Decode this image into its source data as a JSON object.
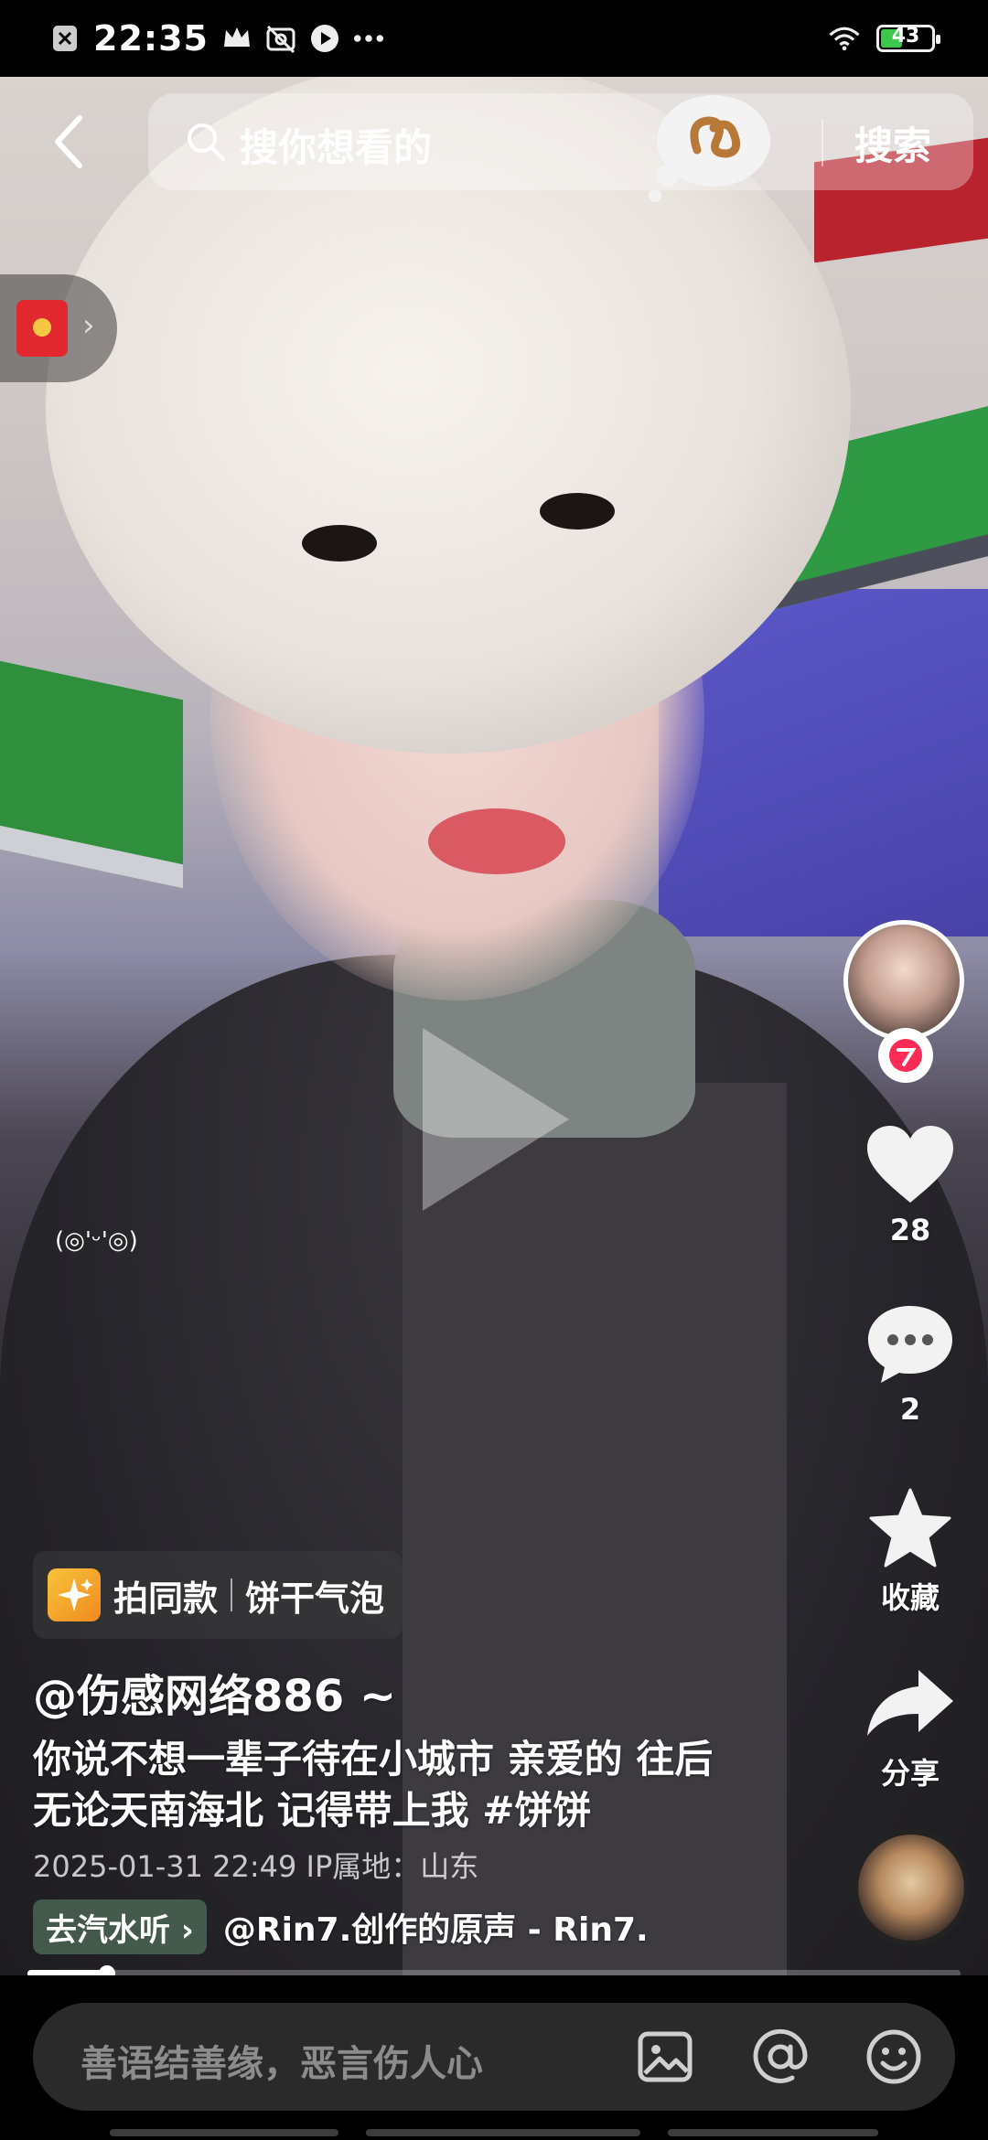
{
  "status_bar": {
    "time": "22:35",
    "battery": "43",
    "battery_level": 0.43
  },
  "top_bar": {
    "search_placeholder": "搜你想看的",
    "search_button": "搜索"
  },
  "video": {
    "overlay_emote": "(◎'ᵕ'◎)"
  },
  "side_rail": {
    "like_count": "28",
    "comment_count": "2",
    "favorite_label": "收藏",
    "share_label": "分享"
  },
  "info": {
    "same_style_label": "拍同款",
    "effect_name": "饼干气泡",
    "author": "@伤感网络886 ~",
    "caption": "你说不想一辈子待在小城市 亲爱的 往后无论天南海北 记得带上我 #饼饼",
    "date_location": "2025-01-31 22:49 IP属地：山东",
    "listen_button": "去汽水听 ›",
    "music": "@Rin7.创作的原声 - Rin7."
  },
  "progress": {
    "played_fraction": 0.085
  },
  "comment_bar": {
    "placeholder": "善语结善缘，恶言伤人心"
  },
  "icons": [
    "close-box-icon",
    "crown-icon",
    "no-photo-icon",
    "play-square-icon",
    "more-dots-icon",
    "wifi-icon",
    "battery-icon",
    "back-arrow-icon",
    "search-icon",
    "pretzel-icon",
    "red-packet-icon",
    "chevron-right-icon",
    "follow-plus-icon",
    "heart-icon",
    "comment-icon",
    "star-icon",
    "share-icon",
    "sparkle-icon",
    "image-icon",
    "at-icon",
    "emoji-icon"
  ],
  "colors": {
    "like_heart": "#ffffff",
    "battery_fill": "#3ac94b",
    "follow_badge": "#fe2c55",
    "sign_red": "#b8232e"
  }
}
